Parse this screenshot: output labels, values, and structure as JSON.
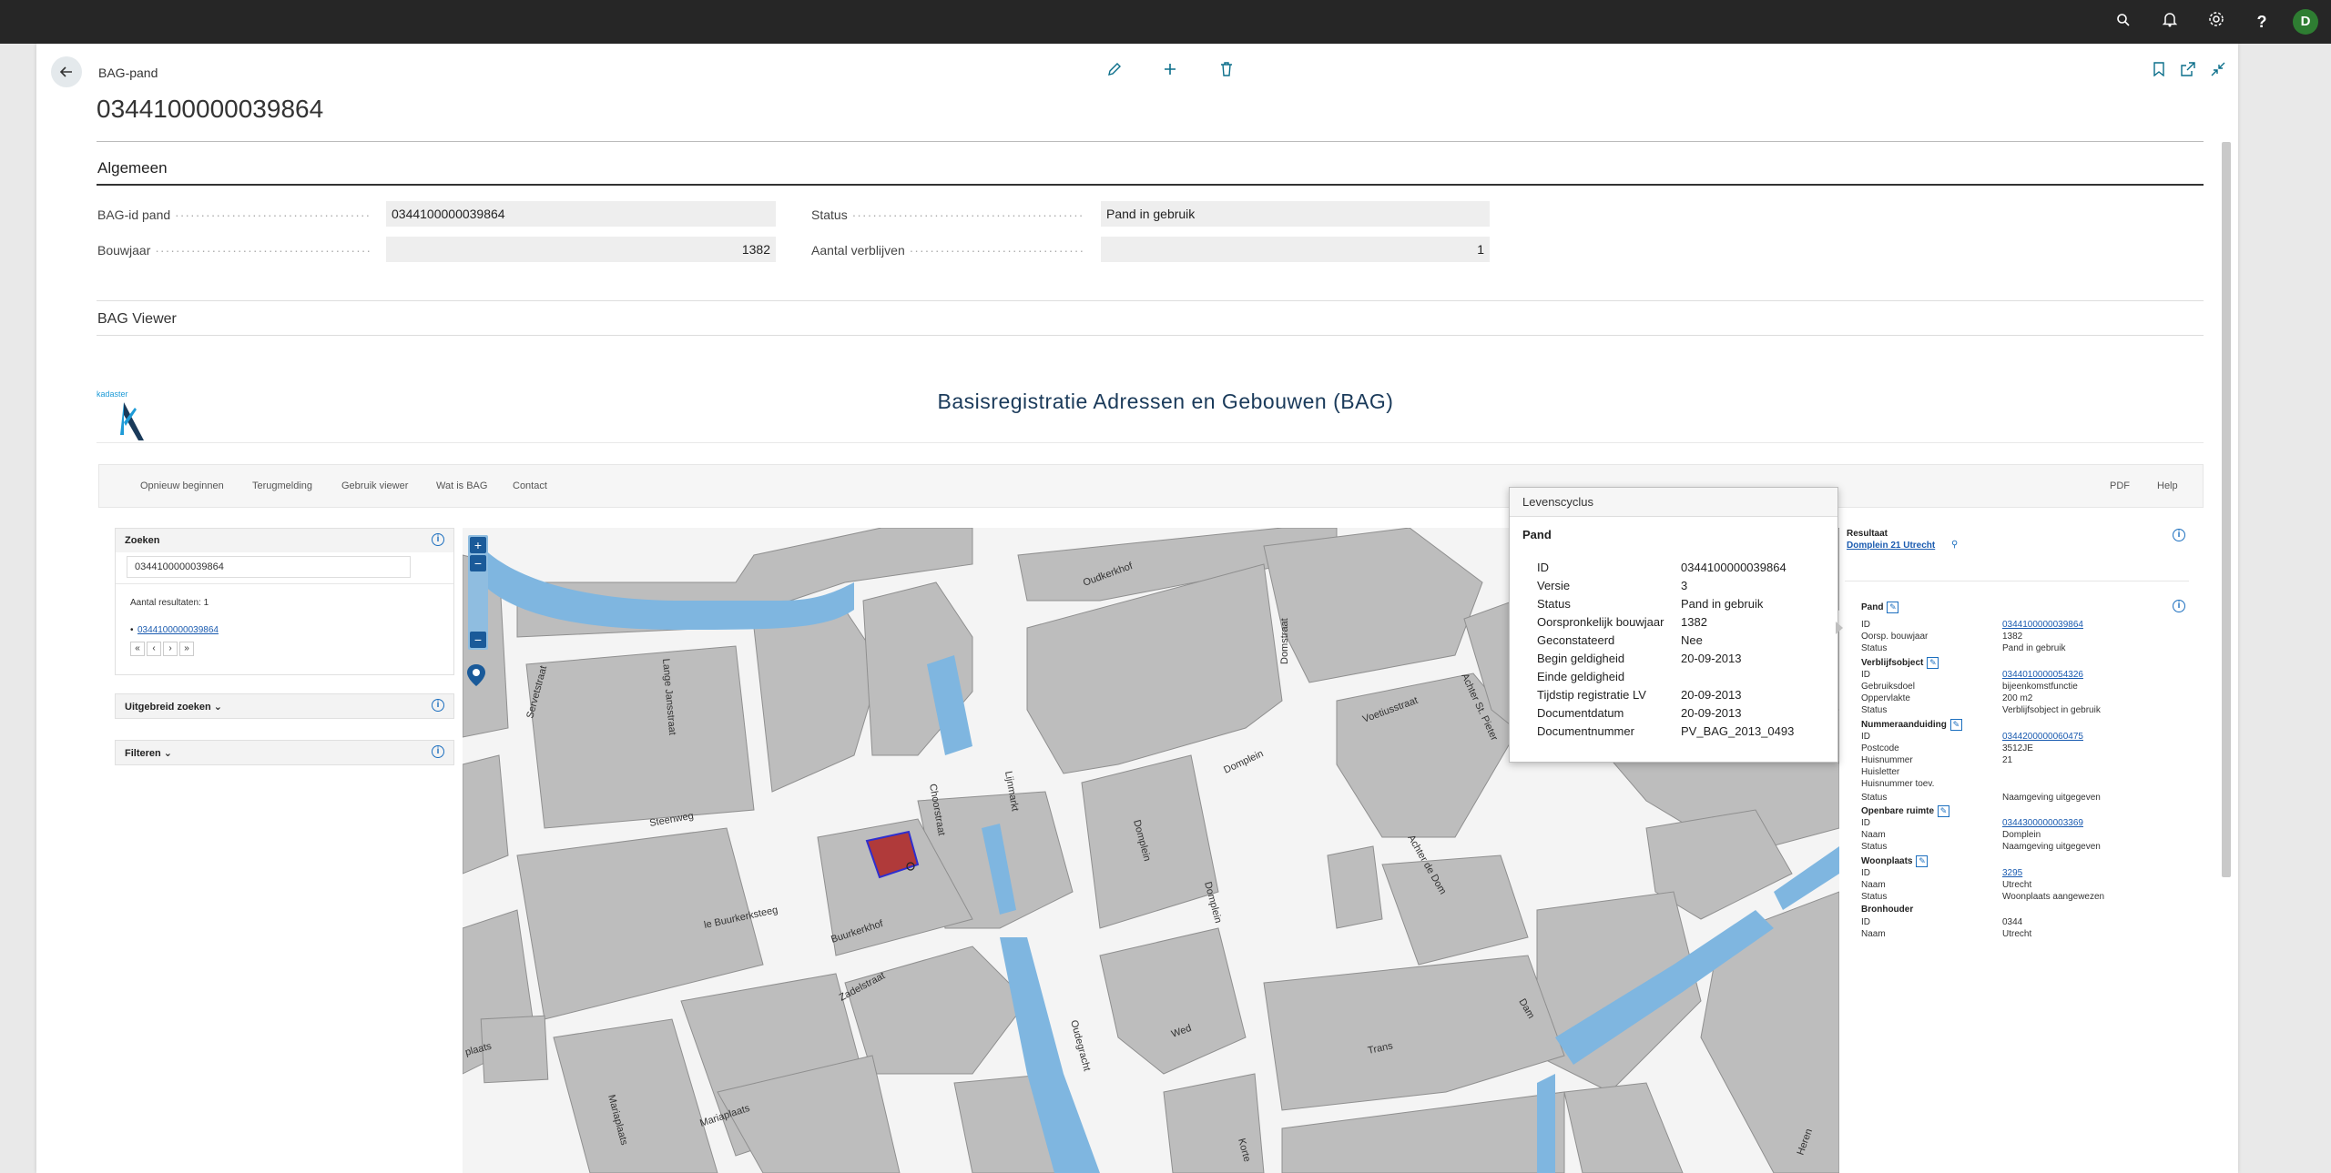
{
  "topbar": {
    "avatar_initial": "D",
    "icons": [
      "search-icon",
      "bell-icon",
      "gear-icon",
      "help-icon"
    ]
  },
  "header": {
    "breadcrumb": "BAG-pand",
    "title": "0344100000039864"
  },
  "algemeen": {
    "title": "Algemeen",
    "fields": {
      "bag_id_label": "BAG-id pand",
      "bag_id_value": "0344100000039864",
      "bouwjaar_label": "Bouwjaar",
      "bouwjaar_value": "1382",
      "status_label": "Status",
      "status_value": "Pand in gebruik",
      "verblijven_label": "Aantal verblijven",
      "verblijven_value": "1"
    }
  },
  "viewer": {
    "title": "BAG Viewer",
    "kadaster_text": "kadaster",
    "bag_title": "Basisregistratie Adressen en Gebouwen (BAG)",
    "nav": [
      "Opnieuw beginnen",
      "Terugmelding",
      "Gebruik viewer",
      "Wat is BAG",
      "Contact"
    ],
    "nav_right": [
      "PDF",
      "Help"
    ],
    "zoeken": {
      "title": "Zoeken",
      "input_value": "0344100000039864",
      "results_count": "Aantal resultaten: 1",
      "result_link": "0344100000039864",
      "pager": [
        "«",
        "‹",
        "›",
        "»"
      ]
    },
    "uitgebreid": {
      "title": "Uitgebreid zoeken ⌄"
    },
    "filteren": {
      "title": "Filteren ⌄"
    },
    "map_labels": {
      "oudkerkhof": "Oudkerkhof",
      "domstraat": "Domstraat",
      "voetiusstraat": "Voetiusstraat",
      "achter_st_pieter": "Achter St. Pieter",
      "domplein1": "Domplein",
      "domplein2": "Domplein",
      "domplein3": "Domplein",
      "steenweg": "Steenweg",
      "buurkerkhof": "Buurkerkhof",
      "zadelstraat": "Zadelstraat",
      "mariaplaats": "Mariaplaats",
      "achter_de_dom": "Achter de Dom",
      "trans": "Trans",
      "wed": "Wed",
      "servetstraat": "Servetstraat",
      "lijnmarkt": "Lijnmarkt",
      "choorstraat": "Choorstraat",
      "plaats": "plaats",
      "lange_jansstraat": "Lange Jansstraat",
      "buurkerksteeg": "le Buurkerksteeg",
      "mariaplaats2": "Mariaplaats",
      "oudegracht": "Oudegracht",
      "korte": "Korte",
      "herenstraat": "Heren",
      "dam": "Dam"
    },
    "popup": {
      "title": "Levenscyclus",
      "subtitle": "Pand",
      "rows": [
        {
          "label": "ID",
          "value": "0344100000039864"
        },
        {
          "label": "Versie",
          "value": "3"
        },
        {
          "label": "Status",
          "value": "Pand in gebruik"
        },
        {
          "label": "Oorspronkelijk bouwjaar",
          "value": "1382"
        },
        {
          "label": "Geconstateerd",
          "value": "Nee"
        },
        {
          "label": "Begin geldigheid",
          "value": "20-09-2013"
        },
        {
          "label": "Einde geldigheid",
          "value": ""
        },
        {
          "label": "Tijdstip registratie LV",
          "value": "20-09-2013"
        },
        {
          "label": "Documentdatum",
          "value": "20-09-2013"
        },
        {
          "label": "Documentnummer",
          "value": "PV_BAG_2013_0493"
        }
      ]
    },
    "result_panel": {
      "title": "Resultaat",
      "address": "Domplein 21 Utrecht",
      "pand": {
        "title": "Pand",
        "id_label": "ID",
        "id_value": "0344100000039864",
        "bouwjaar_label": "Oorsp. bouwjaar",
        "bouwjaar_value": "1382",
        "status_label": "Status",
        "status_value": "Pand in gebruik"
      },
      "verblijfsobject": {
        "title": "Verblijfsobject",
        "id_label": "ID",
        "id_value": "0344010000054326",
        "doel_label": "Gebruiksdoel",
        "doel_value": "bijeenkomstfunctie",
        "opp_label": "Oppervlakte",
        "opp_value": "200 m2",
        "status_label": "Status",
        "status_value": "Verblijfsobject in gebruik"
      },
      "nummeraanduiding": {
        "title": "Nummeraanduiding",
        "id_label": "ID",
        "id_value": "0344200000060475",
        "postcode_label": "Postcode",
        "postcode_value": "3512JE",
        "huisnummer_label": "Huisnummer",
        "huisnummer_value": "21",
        "huisletter_label": "Huisletter",
        "huisletter_value": "",
        "toev_label": "Huisnummer toev.",
        "toev_value": "",
        "status_label": "Status",
        "status_value": "Naamgeving uitgegeven"
      },
      "openbare_ruimte": {
        "title": "Openbare ruimte",
        "id_label": "ID",
        "id_value": "0344300000003369",
        "naam_label": "Naam",
        "naam_value": "Domplein",
        "status_label": "Status",
        "status_value": "Naamgeving uitgegeven"
      },
      "woonplaats": {
        "title": "Woonplaats",
        "id_label": "ID",
        "id_value": "3295",
        "naam_label": "Naam",
        "naam_value": "Utrecht",
        "status_label": "Status",
        "status_value": "Woonplaats aangewezen"
      },
      "bronhouder": {
        "title": "Bronhouder",
        "id_label": "ID",
        "id_value": "0344",
        "naam_label": "Naam",
        "naam_value": "Utrecht"
      }
    }
  },
  "colors": {
    "topbar": "#262626",
    "accent": "#0a6e8a",
    "water": "#7fb6e0",
    "building": "#bdbdbd",
    "selected_building": "#b03a3a"
  }
}
